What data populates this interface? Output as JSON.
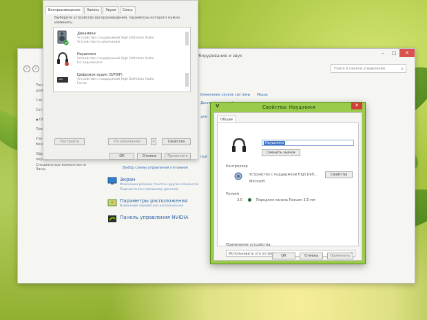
{
  "control_panel": {
    "title": "Оборудование и звук",
    "search_placeholder": "Поиск в панели управления",
    "sidebar": [
      "Панель",
      "домашн",
      "Систе",
      "Сеть и",
      "Обору",
      "Програ",
      "Учетн",
      "безоп",
      "Оформ",
      "персон",
      "Часы,",
      "Специ"
    ],
    "see_also": "Специальные возможности",
    "links_row": [
      "Изменение звуков системы",
      "Мышь"
    ],
    "links_row2": "Диспетчер устройств",
    "sections": [
      {
        "name": "Экран",
        "desc1": "Изменение размера текста и других элементов",
        "desc2": "Подключение к внешнему дисплею"
      },
      {
        "name": "Параметры расположения",
        "desc1": "Изменение параметров расположения",
        "desc2": ""
      },
      {
        "name": "Панель управления NVIDIA",
        "desc1": "",
        "desc2": ""
      }
    ],
    "small_texts": [
      "Выбор схемы управления питанием",
      "для",
      "при"
    ]
  },
  "sound_dialog": {
    "tabs": [
      "Воспроизведение",
      "Запись",
      "Звуки",
      "Связь"
    ],
    "instruction": "Выберите устройство воспроизведения, параметры которого нужно изменить:",
    "devices": [
      {
        "name": "Динамики",
        "line1": "Устройство с поддержкой High Definition Audio",
        "line2": "Устройство по умолчанию"
      },
      {
        "name": "Наушники",
        "line1": "Устройство с поддержкой High Definition Audio",
        "line2": "Не подключено"
      },
      {
        "name": "Цифровое аудио (S/PDIF)",
        "line1": "Устройство с поддержкой High Definition Audio",
        "line2": "Готов"
      }
    ],
    "buttons": {
      "configure": "Настроить",
      "default": "По умолчанию",
      "properties": "Свойства",
      "ok": "ОК",
      "cancel": "Отмена",
      "apply": "Применить"
    }
  },
  "hp_dialog": {
    "title": "Свойства: Наушники",
    "tab": "Общие",
    "name_value": "Наушники",
    "change_icon": "Сменить значок",
    "controller_label": "Контроллер",
    "controller_name": "Устройство с поддержкой High Defi...",
    "controller_vendor": "Microsoft",
    "properties_btn": "Свойства",
    "jacks_label": "Разъем",
    "jack_size": "3.5",
    "jack_text": "Передняя панель Разъем 3,5 мм",
    "usage_label": "Применение устройства:",
    "usage_value": "Использовать это устройство (вкл.)",
    "buttons": {
      "ok": "ОК",
      "cancel": "Отмена",
      "apply": "Применить"
    }
  }
}
